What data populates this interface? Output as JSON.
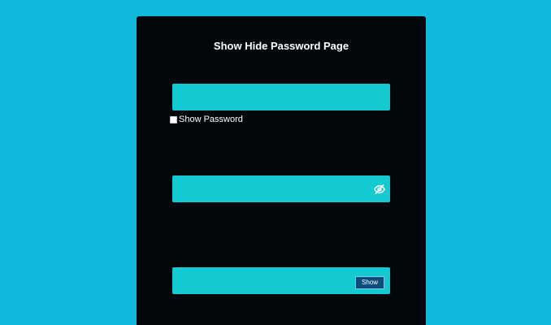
{
  "page": {
    "title": "Show Hide Password Page"
  },
  "fields": {
    "field1": {
      "value": "",
      "placeholder": ""
    },
    "field2": {
      "value": "",
      "placeholder": ""
    },
    "field3": {
      "value": "",
      "placeholder": ""
    }
  },
  "checkbox": {
    "label": "Show Password",
    "checked": false
  },
  "icons": {
    "eye": "eye-slash-icon"
  },
  "buttons": {
    "show_label": "Show"
  },
  "colors": {
    "background": "#0fb9de",
    "card": "#03070b",
    "field": "#13c9d2",
    "button": "#0a4d7a",
    "text": "#ffffff"
  }
}
